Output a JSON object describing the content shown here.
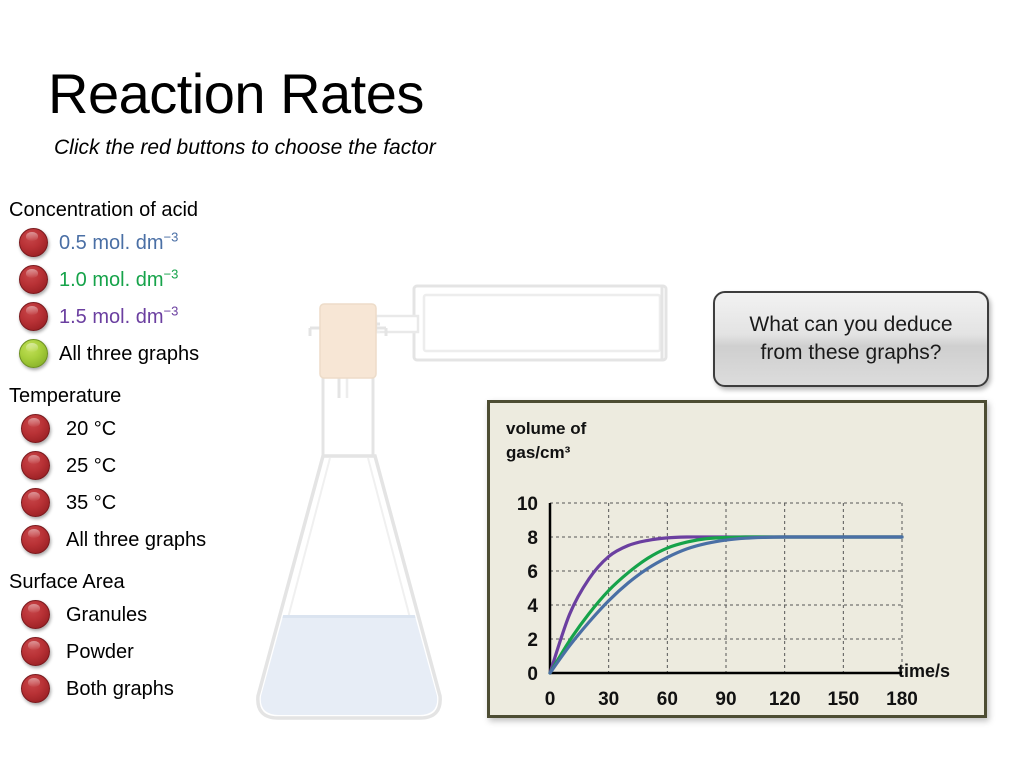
{
  "title": "Reaction Rates",
  "subtitle": "Click the red buttons to choose the factor",
  "menu": {
    "sections": [
      {
        "heading": "Concentration of acid",
        "items": [
          {
            "label": "0.5 mol. dm",
            "sup": "−3",
            "color": "#4a6fa5",
            "bullet": "red"
          },
          {
            "label": "1.0 mol. dm",
            "sup": "−3",
            "color": "#16a34a",
            "bullet": "red"
          },
          {
            "label": "1.5 mol. dm",
            "sup": "−3",
            "color": "#6b3fa0",
            "bullet": "red"
          },
          {
            "label": "All three graphs",
            "sup": "",
            "color": "#000000",
            "bullet": "green"
          }
        ]
      },
      {
        "heading": "Temperature",
        "items": [
          {
            "label": "20  °C",
            "sup": "",
            "color": "#000000",
            "bullet": "red"
          },
          {
            "label": "25  °C",
            "sup": "",
            "color": "#000000",
            "bullet": "red"
          },
          {
            "label": "35  °C",
            "sup": "",
            "color": "#000000",
            "bullet": "red"
          },
          {
            "label": "All three graphs",
            "sup": "",
            "color": "#000000",
            "bullet": "red"
          }
        ]
      },
      {
        "heading": "Surface Area",
        "items": [
          {
            "label": "Granules",
            "sup": "",
            "color": "#000000",
            "bullet": "red"
          },
          {
            "label": "Powder",
            "sup": "",
            "color": "#000000",
            "bullet": "red"
          },
          {
            "label": "Both graphs",
            "sup": "",
            "color": "#000000",
            "bullet": "red"
          }
        ]
      }
    ]
  },
  "deduce_button": {
    "text": "What can you deduce\nfrom these graphs?"
  },
  "chart_data": {
    "type": "line",
    "title": "",
    "ylabel": "volume of\ngas/cm³",
    "xlabel": "time/s",
    "xlim": [
      0,
      180
    ],
    "ylim": [
      0,
      10
    ],
    "xticks": [
      "0",
      "30",
      "60",
      "90",
      "120",
      "150",
      "180"
    ],
    "yticks": [
      "0",
      "2",
      "4",
      "6",
      "8",
      "10"
    ],
    "grid": true,
    "legend_position": "none",
    "panel_background": "#edebdf",
    "panel_border": "#4d4d33",
    "x": [
      0,
      10,
      20,
      30,
      40,
      50,
      60,
      70,
      80,
      90,
      100,
      110,
      120,
      130,
      140,
      150,
      160,
      170,
      180
    ],
    "series": [
      {
        "name": "1.5 mol. dm−3",
        "color": "#6b3fa0",
        "values": [
          0,
          3.45,
          5.55,
          6.85,
          7.5,
          7.8,
          7.95,
          8.0,
          8.0,
          8.0,
          8.0,
          8.0,
          8.0,
          8.0,
          8.0,
          8.0,
          8.0,
          8.0,
          8.0
        ]
      },
      {
        "name": "1.0 mol. dm−3",
        "color": "#16a34a",
        "values": [
          0,
          1.9,
          3.5,
          4.85,
          5.9,
          6.75,
          7.35,
          7.7,
          7.9,
          7.97,
          8.0,
          8.0,
          8.0,
          8.0,
          8.0,
          8.0,
          8.0,
          8.0,
          8.0
        ]
      },
      {
        "name": "0.5 mol. dm−3",
        "color": "#4a6fa5",
        "values": [
          0,
          1.6,
          3.0,
          4.25,
          5.3,
          6.15,
          6.8,
          7.3,
          7.62,
          7.82,
          7.93,
          7.98,
          8.0,
          8.0,
          8.0,
          8.0,
          8.0,
          8.0,
          8.0
        ]
      }
    ]
  },
  "apparatus": {
    "flask_name": "conical flask",
    "liquid_color": "#e7edf6",
    "bung_color": "#f6e4d2",
    "glass_outline": "#e2e2e2",
    "syringe_name": "gas syringe"
  }
}
